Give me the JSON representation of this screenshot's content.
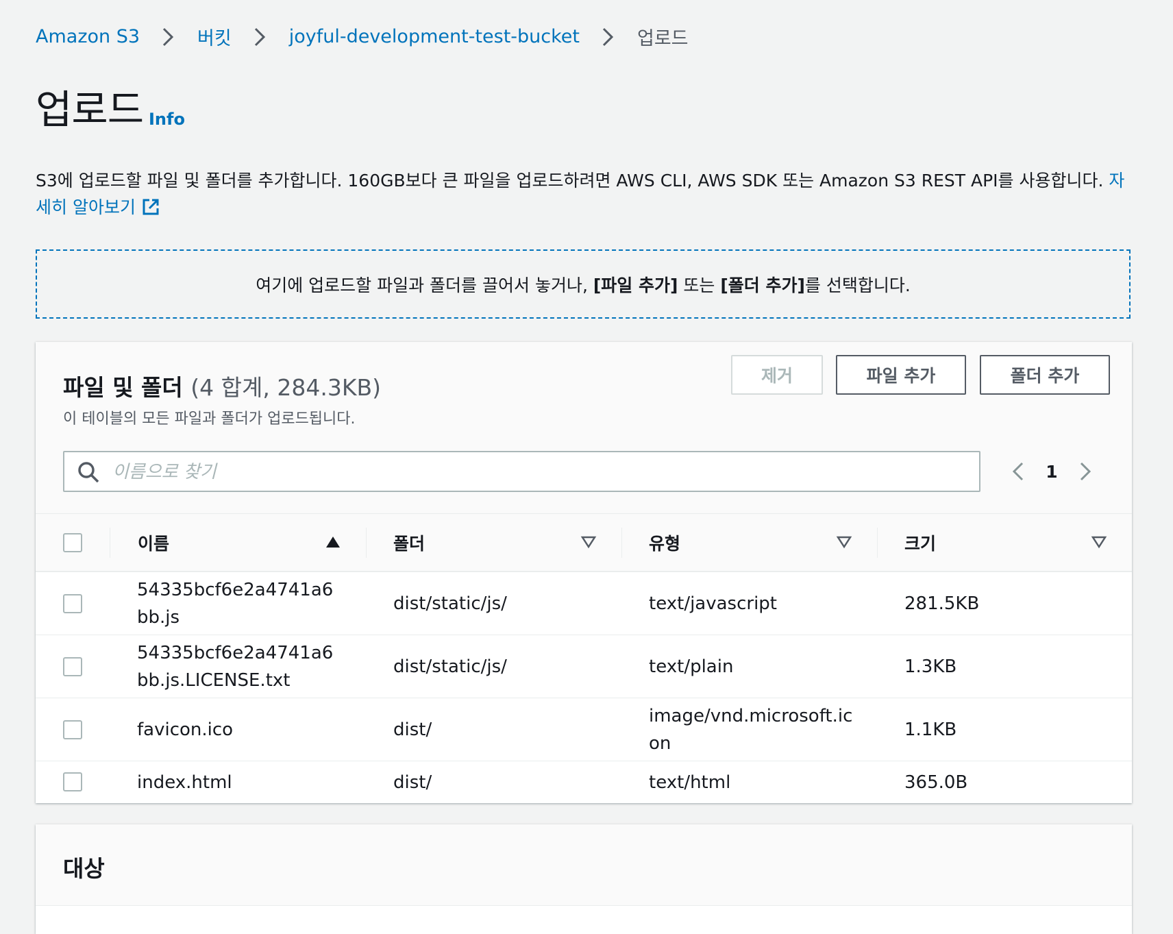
{
  "breadcrumb": {
    "items": [
      "Amazon S3",
      "버킷",
      "joyful-development-test-bucket"
    ],
    "current": "업로드"
  },
  "page": {
    "title": "업로드",
    "info": "Info",
    "description": "S3에 업로드할 파일 및 폴더를 추가합니다. 160GB보다 큰 파일을 업로드하려면 AWS CLI, AWS SDK 또는 Amazon S3 REST API를 사용합니다.",
    "learn_more": "자세히 알아보기"
  },
  "dropzone": {
    "text_before": "여기에 업로드할 파일과 폴더를 끌어서 놓거나, ",
    "add_files": "[파일 추가]",
    "middle": " 또는 ",
    "add_folder": "[폴더 추가]",
    "text_after": "를 선택합니다."
  },
  "files_panel": {
    "title": "파일 및 폴더",
    "count": "(4 합계, 284.3KB)",
    "subtitle": "이 테이블의 모든 파일과 폴더가 업로드됩니다.",
    "remove_button": "제거",
    "add_files_button": "파일 추가",
    "add_folder_button": "폴더 추가",
    "search_placeholder": "이름으로 찾기",
    "page_number": "1",
    "columns": [
      "이름",
      "폴더",
      "유형",
      "크기"
    ],
    "rows": [
      {
        "name": "54335bcf6e2a4741a6bb.js",
        "folder": "dist/static/js/",
        "type": "text/javascript",
        "size": "281.5KB"
      },
      {
        "name": "54335bcf6e2a4741a6bb.js.LICENSE.txt",
        "folder": "dist/static/js/",
        "type": "text/plain",
        "size": "1.3KB"
      },
      {
        "name": "favicon.ico",
        "folder": "dist/",
        "type": "image/vnd.microsoft.icon",
        "size": "1.1KB"
      },
      {
        "name": "index.html",
        "folder": "dist/",
        "type": "text/html",
        "size": "365.0B"
      }
    ]
  },
  "destination_panel": {
    "title": "대상"
  },
  "colors": {
    "link": "#0073bb",
    "background": "#f2f3f3",
    "text": "#16191f",
    "muted": "#545b64"
  }
}
